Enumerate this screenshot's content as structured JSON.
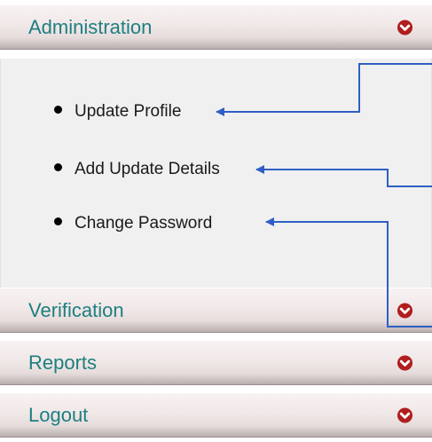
{
  "accordion": {
    "sections": [
      {
        "label": "Administration",
        "state": "expanded",
        "icon": "chevron-down-circle-icon"
      },
      {
        "label": "Verification",
        "state": "collapsed",
        "icon": "chevron-down-circle-icon"
      },
      {
        "label": "Reports",
        "state": "collapsed",
        "icon": "chevron-down-circle-icon"
      },
      {
        "label": "Logout",
        "state": "collapsed",
        "icon": "chevron-down-circle-icon"
      }
    ],
    "administration_items": [
      {
        "label": "Update Profile"
      },
      {
        "label": "Add Update Details"
      },
      {
        "label": "Change Password"
      }
    ]
  },
  "colors": {
    "header_text": "#1e7f80",
    "toggle_icon": "#b01e1e",
    "arrow": "#2f5fc4",
    "panel_background": "#f0f0f0"
  }
}
